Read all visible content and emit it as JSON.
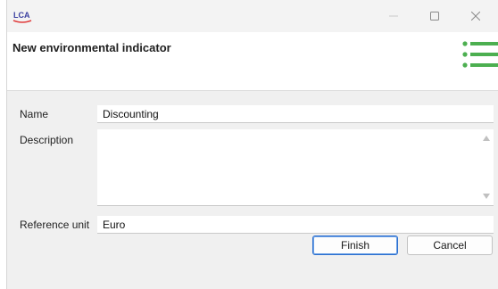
{
  "titlebar": {
    "app_logo_text": "LCA",
    "icons": [
      "minimize-icon",
      "maximize-icon",
      "close-icon"
    ]
  },
  "header": {
    "title": "New environmental indicator",
    "icon": "list-icon",
    "accent_color": "#4caf50"
  },
  "form": {
    "name_label": "Name",
    "name_value": "Discounting",
    "description_label": "Description",
    "description_value": "",
    "reference_unit_label": "Reference unit",
    "reference_unit_value": "Euro"
  },
  "buttons": {
    "finish_label": "Finish",
    "cancel_label": "Cancel"
  }
}
